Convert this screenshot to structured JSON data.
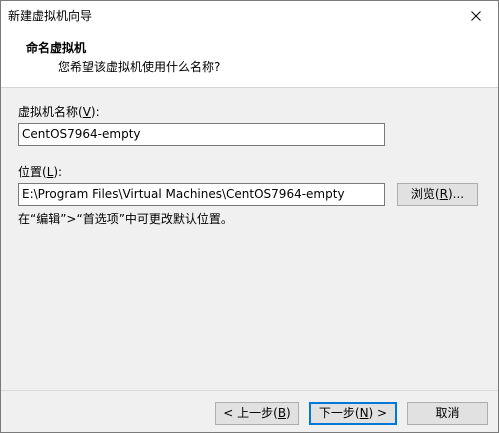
{
  "window": {
    "title": "新建虚拟机向导"
  },
  "header": {
    "title": "命名虚拟机",
    "subtitle": "您希望该虚拟机使用什么名称?"
  },
  "vm_name": {
    "label_prefix": "虚拟机名称(",
    "label_key": "V",
    "label_suffix": "):",
    "value": "CentOS7964-empty"
  },
  "location": {
    "label_prefix": "位置(",
    "label_key": "L",
    "label_suffix": "):",
    "value": "E:\\Program Files\\Virtual Machines\\CentOS7964-empty",
    "browse_prefix": "浏览(",
    "browse_key": "R",
    "browse_suffix": ")..."
  },
  "note": "在“编辑”>“首选项”中可更改默认位置。",
  "footer": {
    "back_prefix": "< 上一步(",
    "back_key": "B",
    "back_suffix": ")",
    "next_prefix": "下一步(",
    "next_key": "N",
    "next_suffix": ") >",
    "cancel": "取消"
  },
  "icons": {
    "close": "close-icon"
  },
  "colors": {
    "focus_border": "#0078d7",
    "button_face": "#e1e1e1",
    "dialog_bg": "#f0f0f0"
  }
}
